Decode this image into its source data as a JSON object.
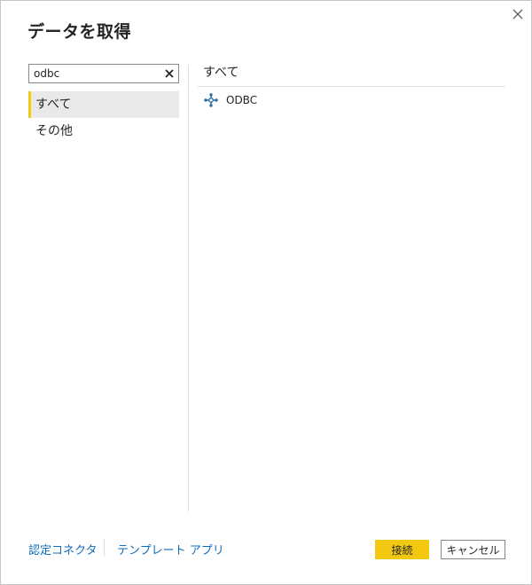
{
  "dialog": {
    "title": "データを取得",
    "close_icon": "close-icon"
  },
  "search": {
    "value": "odbc",
    "clear_icon": "clear-icon"
  },
  "categories": [
    {
      "label": "すべて",
      "selected": true
    },
    {
      "label": "その他",
      "selected": false
    }
  ],
  "results": {
    "header": "すべて",
    "items": [
      {
        "label": "ODBC",
        "icon": "odbc-connector-icon"
      }
    ]
  },
  "footer": {
    "certified_connectors_link": "認定コネクタ",
    "template_apps_link": "テンプレート アプリ",
    "connect_label": "接続",
    "cancel_label": "キャンセル"
  },
  "colors": {
    "accent": "#f2c811",
    "link": "#0f6cbd",
    "selected_bg": "#e9e9e9"
  }
}
